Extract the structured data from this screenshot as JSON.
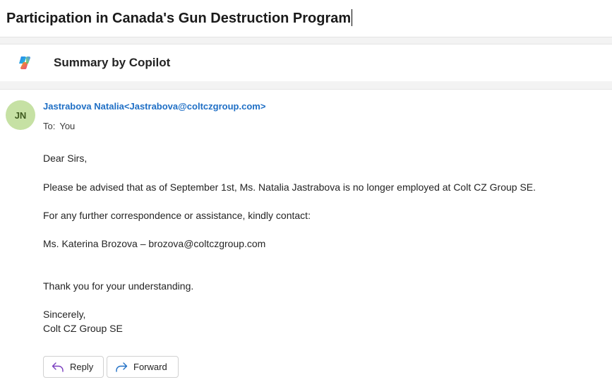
{
  "subject": "Participation in Canada's Gun Destruction Program",
  "copilot": {
    "label": "Summary by Copilot",
    "icon": "copilot-icon"
  },
  "message": {
    "avatar_initials": "JN",
    "avatar_color": "#c6e1a4",
    "sender": "Jastrabova Natalia<Jastrabova@coltczgroup.com>",
    "to_label": "To:",
    "to_value": "You",
    "body": {
      "greeting": "Dear Sirs,",
      "para1": "Please be advised that as of September 1st, Ms. Natalia Jastrabova is no longer employed at Colt CZ Group SE.",
      "para2": "For any further correspondence or assistance, kindly contact:",
      "contact": "Ms. Katerina Brozova – brozova@coltczgroup.com",
      "thanks": "Thank you for your understanding.",
      "closing": "Sincerely,",
      "signature": "Colt CZ Group SE"
    }
  },
  "actions": {
    "reply_label": "Reply",
    "forward_label": "Forward",
    "reply_icon": "reply-arrow-icon",
    "forward_icon": "forward-arrow-icon"
  },
  "colors": {
    "link": "#1f6fc5",
    "accent_reply": "#7a3fbf",
    "accent_forward": "#1f6fc5"
  }
}
